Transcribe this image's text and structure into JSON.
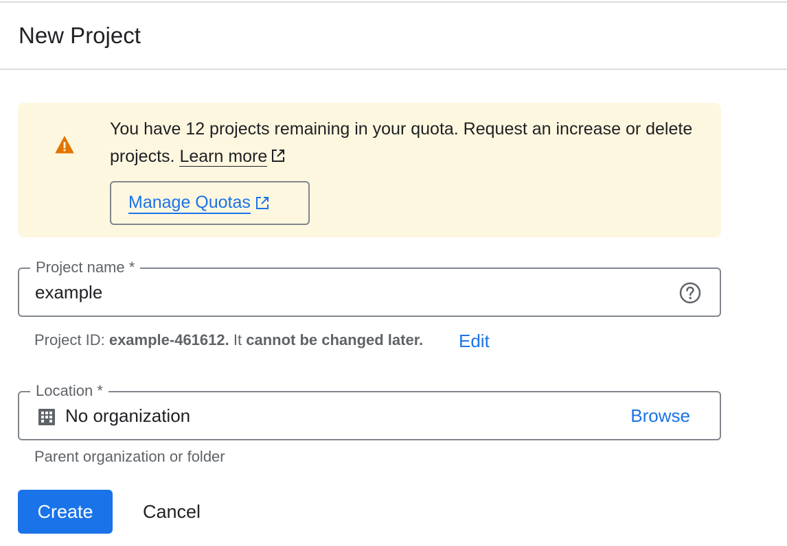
{
  "header": {
    "title": "New Project"
  },
  "quota_banner": {
    "message": "You have 12 projects remaining in your quota. Request an increase or delete projects.",
    "learn_more": "Learn more",
    "manage_button": "Manage Quotas",
    "icon": "warning-icon",
    "background_color": "#fef7e0",
    "icon_color": "#e37400"
  },
  "project_name": {
    "label": "Project name *",
    "value": "example",
    "help_icon": "help-circle-icon"
  },
  "project_id": {
    "prefix": "Project ID:",
    "id": "example-461612.",
    "middle": "It",
    "suffix": "cannot be changed later.",
    "edit_label": "Edit"
  },
  "location": {
    "label": "Location *",
    "value": "No organization",
    "icon": "organization-icon",
    "browse_label": "Browse",
    "hint": "Parent organization or folder"
  },
  "actions": {
    "create_label": "Create",
    "cancel_label": "Cancel",
    "primary_color": "#1a73e8"
  }
}
